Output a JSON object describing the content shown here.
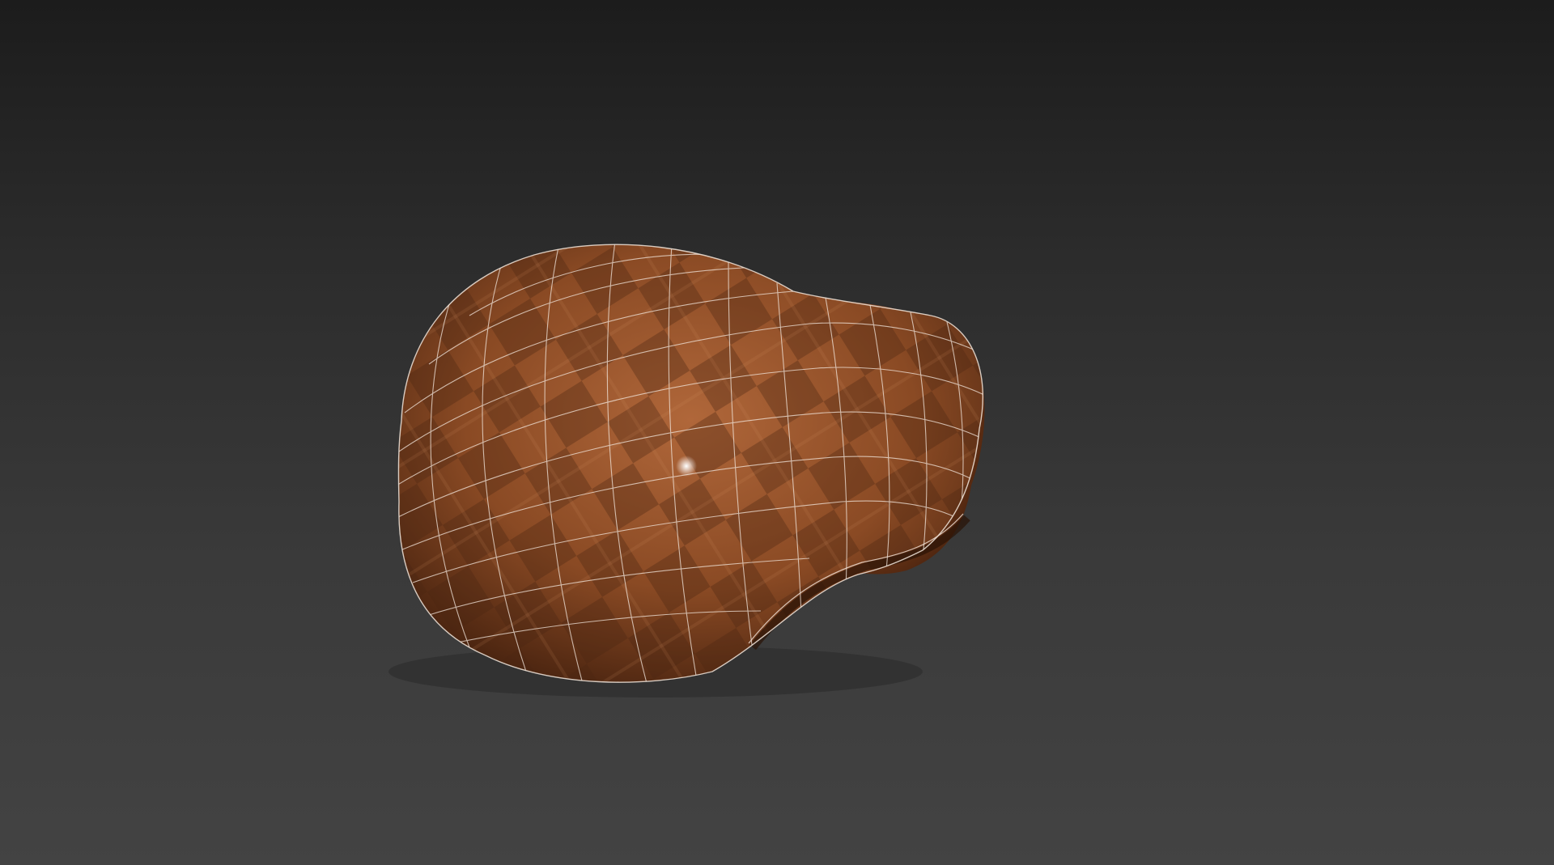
{
  "viewport": {
    "background_top": "#1c1c1c",
    "background_bottom": "#434343"
  },
  "model": {
    "object": "flat-cap",
    "material_color": "#8a4a24",
    "material_dark": "#4a2412",
    "check_color": "#5c2e14",
    "wireframe_color": "#f2e6dc",
    "highlight_color": "#ffffff",
    "display_mode": "shaded-with-wireframe"
  }
}
